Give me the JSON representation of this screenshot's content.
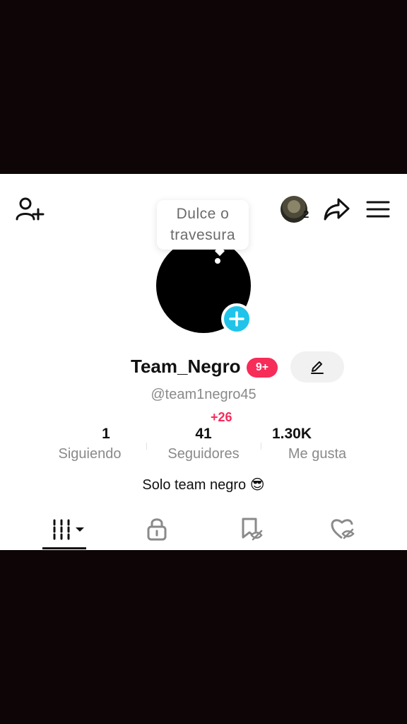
{
  "header": {
    "add_user_icon": "person-plus-icon",
    "friends_avatar_count": "2",
    "share_icon": "share-arrow-icon",
    "menu_icon": "hamburger-menu-icon"
  },
  "tooltip": {
    "line1": "Dulce o",
    "line2": "travesura"
  },
  "profile": {
    "username": "Team_Negro",
    "notifications": "9+",
    "handle": "@team1negro45",
    "new_followers": "+26",
    "bio": "Solo team negro 😎"
  },
  "stats": [
    {
      "value": "1",
      "label": "Siguiendo"
    },
    {
      "value": "41",
      "label": "Seguidores"
    },
    {
      "value": "1.30K",
      "label": "Me gusta"
    }
  ],
  "tabs": [
    "videos-grid-icon",
    "private-lock-icon",
    "saved-icon",
    "liked-icon"
  ],
  "colors": {
    "accent_red": "#f62c59",
    "accent_cyan": "#20c4ea",
    "background_dark": "#0d0506"
  }
}
